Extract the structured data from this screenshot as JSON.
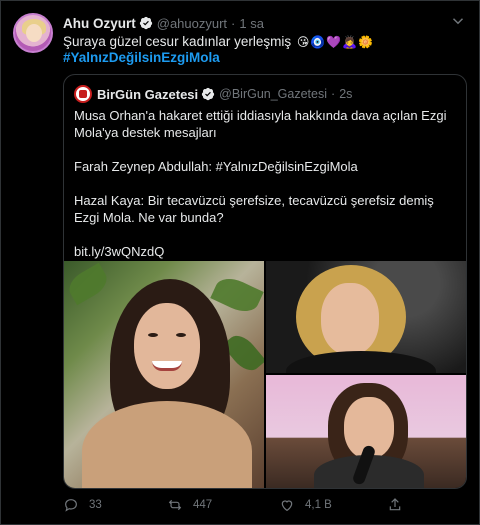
{
  "tweet": {
    "author_name": "Ahu Ozyurt",
    "author_handle": "@ahuozyurt",
    "separator": "·",
    "time": "1 sa",
    "text": "Şuraya güzel cesur kadınlar yerleşmiş",
    "emojis": "😘🧿💜🙇‍♀️🌼",
    "hashtag": "#YalnızDeğilsinEzgiMola"
  },
  "quoted_tweet": {
    "author_name": "BirGün Gazetesi",
    "author_handle": "@BirGun_Gazetesi",
    "separator": "·",
    "time": "2s",
    "paragraphs": [
      "Musa Orhan'a hakaret ettiği iddiasıyla hakkında dava açılan Ezgi Mola'ya destek mesajları",
      "Farah Zeynep Abdullah: #YalnızDeğilsinEzgiMola",
      "Hazal Kaya: Bir tecavüzcü şerefsize, tecavüzcü şerefsiz demiş Ezgi Mola. Ne var bunda?",
      "bit.ly/3wQNzdQ"
    ]
  },
  "actions": {
    "replies": "33",
    "retweets": "447",
    "likes": "4,1 B"
  },
  "icons": {
    "verified": "verified-badge-icon",
    "more": "chevron-down-icon",
    "reply": "reply-icon",
    "retweet": "retweet-icon",
    "like": "heart-icon",
    "share": "share-icon"
  },
  "colors": {
    "background": "#000000",
    "accent": "#1d9bf0",
    "secondary_text": "#71767b",
    "border": "#2f3336"
  }
}
